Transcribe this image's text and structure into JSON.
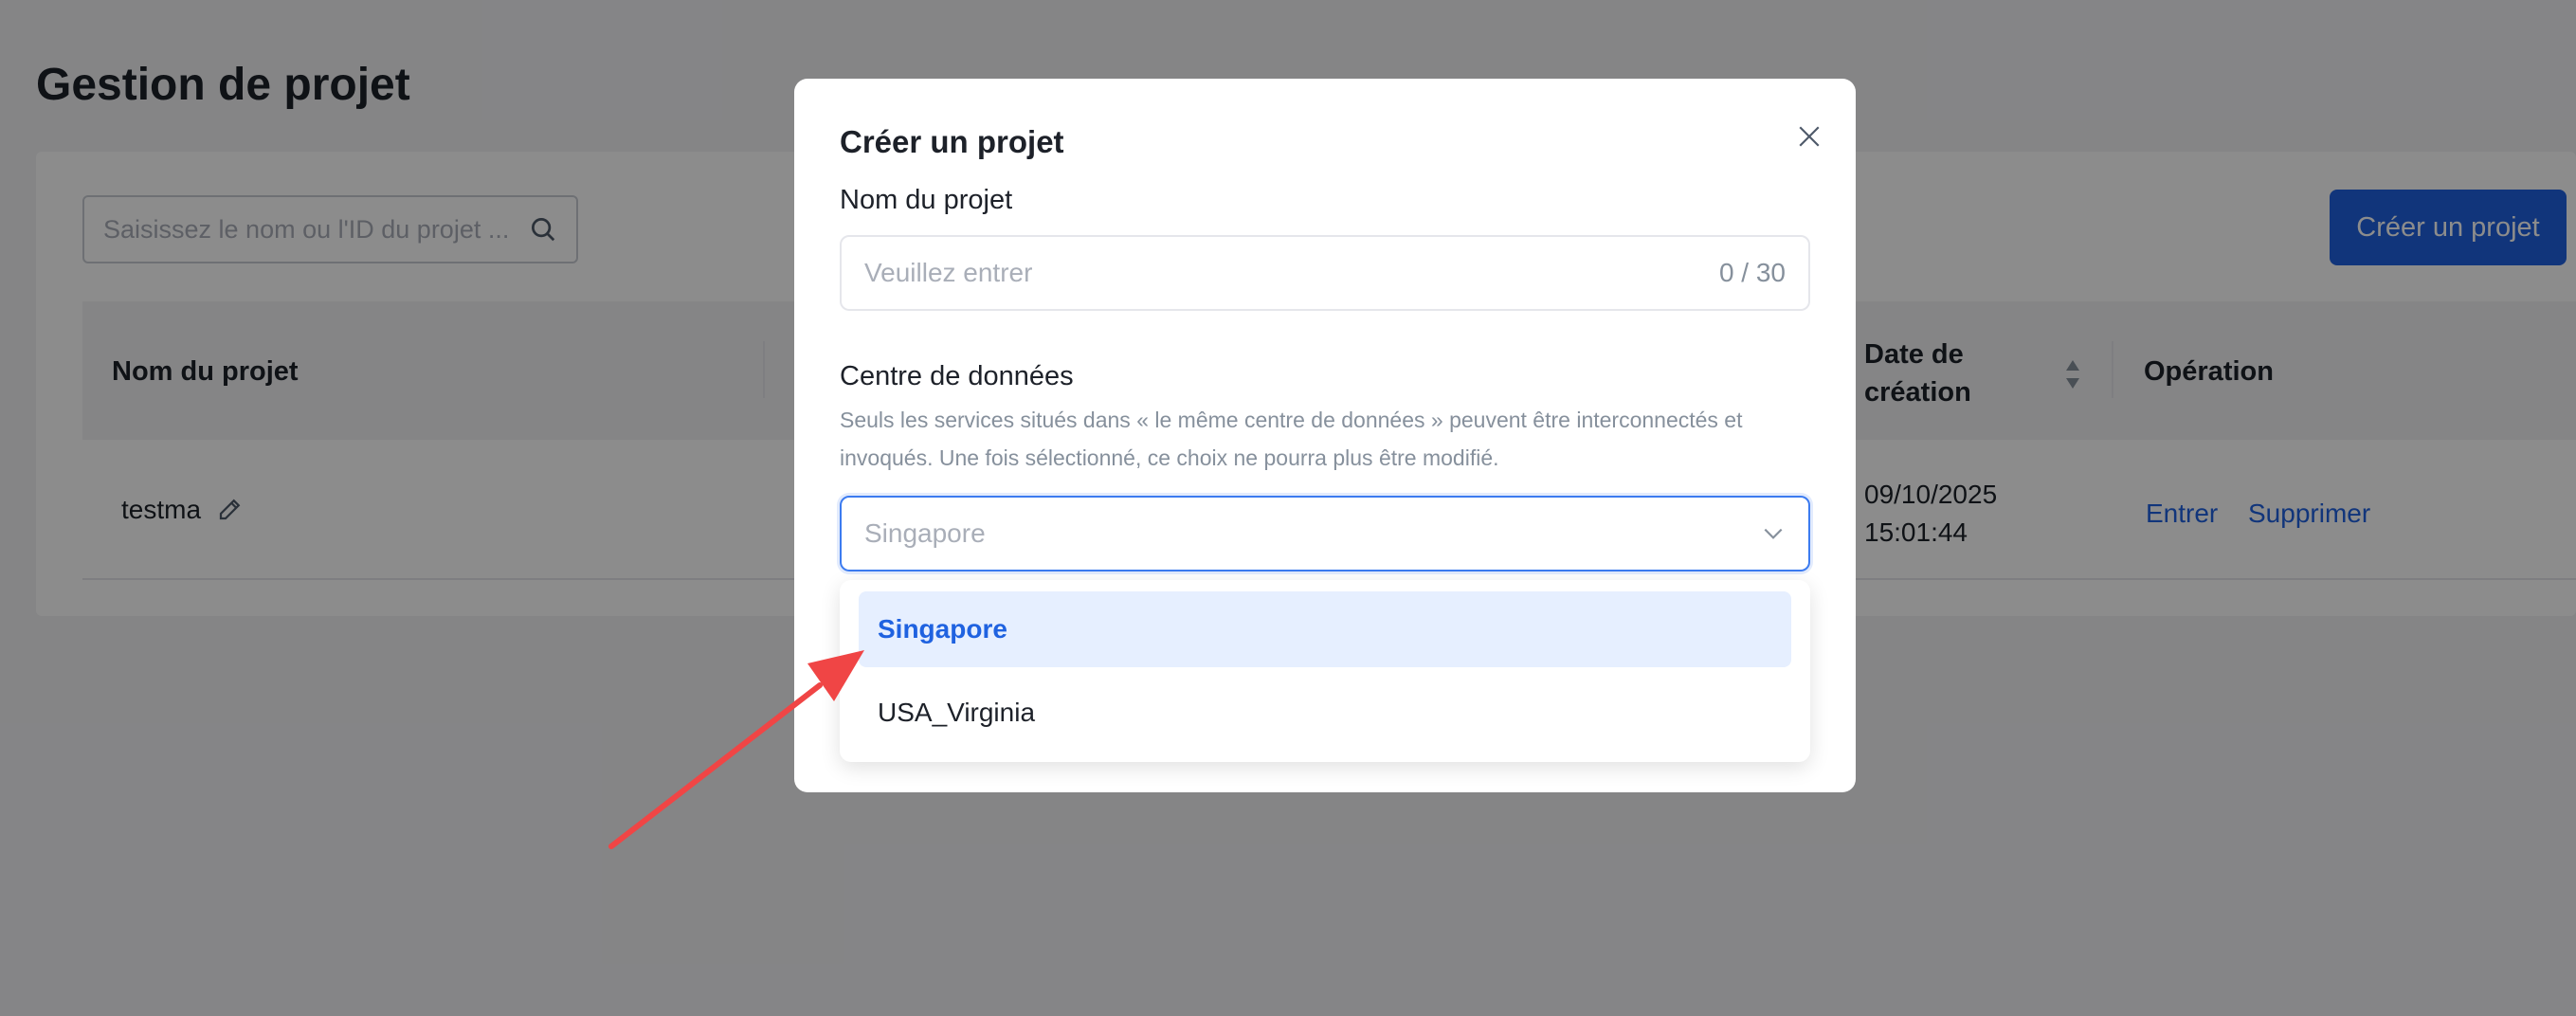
{
  "page": {
    "title": "Gestion de projet",
    "search_placeholder": "Saisissez le nom ou l'ID du projet ...",
    "create_button": "Créer un projet"
  },
  "table": {
    "columns": [
      "Nom du projet",
      "Date de création",
      "Opération"
    ],
    "column_date_line1": "Date de",
    "column_date_line2": "création",
    "rows": [
      {
        "name": "testma",
        "date": "09/10/2025",
        "time": "15:01:44",
        "actions": [
          "Entrer",
          "Supprimer"
        ]
      }
    ]
  },
  "modal": {
    "title": "Créer un projet",
    "name_label": "Nom du projet",
    "name_placeholder": "Veuillez entrer",
    "name_counter": "0 / 30",
    "dc_label": "Centre de données",
    "dc_hint": "Seuls les services situés dans « le même centre de données » peuvent être interconnectés et invoqués. Une fois sélectionné, ce choix ne pourra plus être modifié.",
    "dc_selected": "Singapore",
    "dc_options": [
      "Singapore",
      "USA_Virginia"
    ]
  },
  "colors": {
    "primary": "#1f62e0",
    "option_active_bg": "#e6efff",
    "annotation_arrow": "#f04545"
  }
}
